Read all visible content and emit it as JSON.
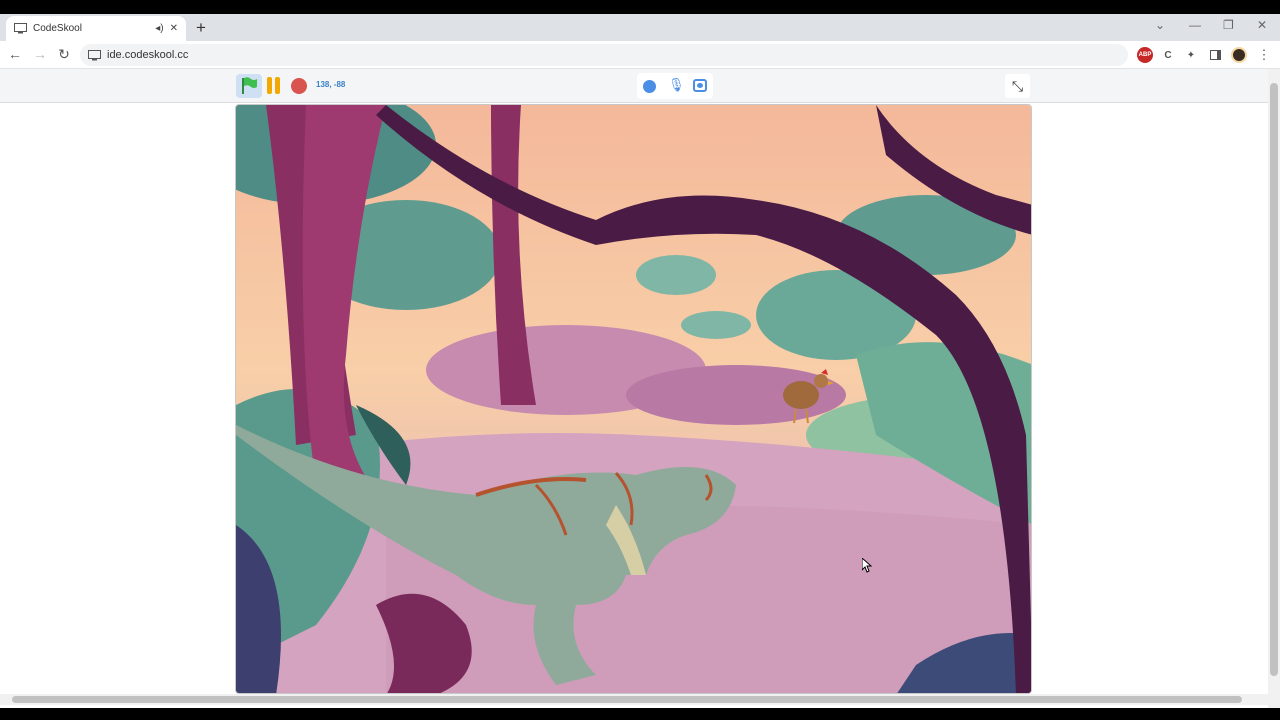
{
  "browser": {
    "tab_title": "CodeSkool",
    "new_tab_symbol": "+",
    "url": "ide.codeskool.cc",
    "extensions": [
      "abp-icon",
      "c-icon",
      "puzzle-icon",
      "sidepanel-icon",
      "avatar"
    ],
    "abp_label": "ABP"
  },
  "controls": {
    "flag": "green-flag-icon",
    "pause": "pause-icon",
    "stop": "stop-icon",
    "coordinates": "138, -88",
    "accent": "#4a8ee6"
  },
  "stage": {
    "description_icons": [
      "dinosaur-sprite",
      "chicken-sprite",
      "jungle-backdrop"
    ]
  }
}
